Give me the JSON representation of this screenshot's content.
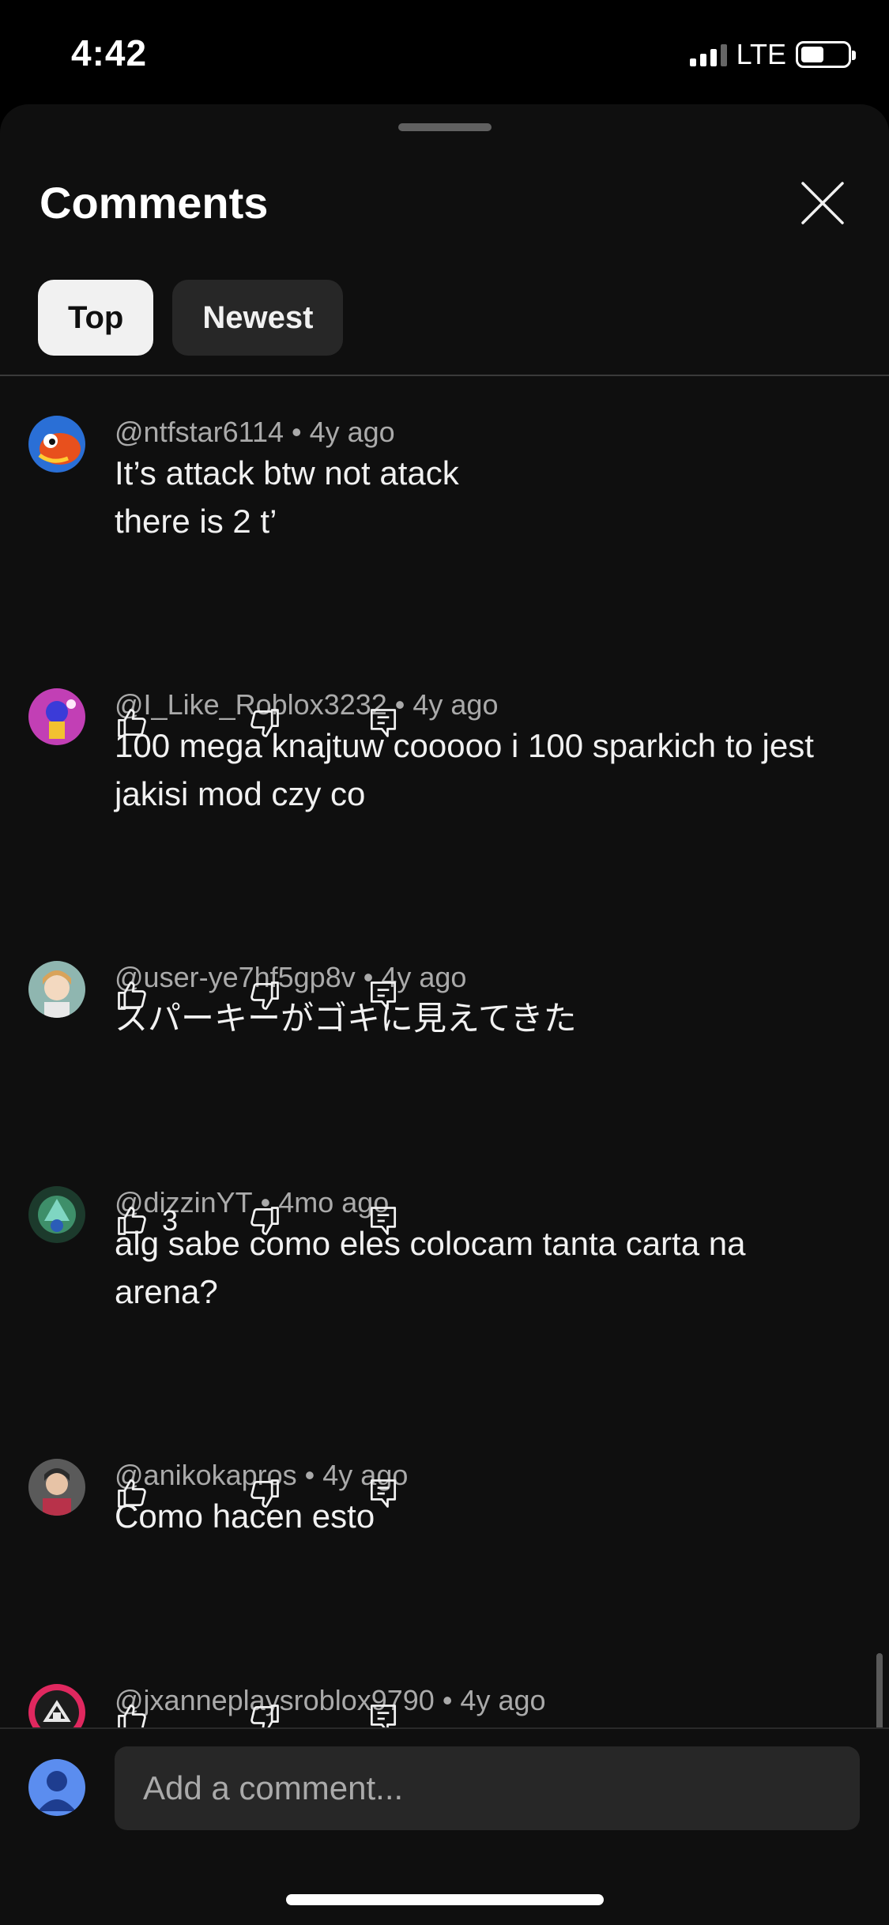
{
  "status_bar": {
    "time": "4:42",
    "network": "LTE",
    "signal_bars": 3
  },
  "sheet": {
    "title": "Comments",
    "tabs": [
      {
        "label": "Top",
        "active": true
      },
      {
        "label": "Newest",
        "active": false
      }
    ]
  },
  "comments": [
    {
      "author": "@ntfstar6114",
      "age": "4y ago",
      "text": "It’s attack btw not atack\n there is 2 t’",
      "likes": "",
      "avatar_icon": "fish-avatar-icon"
    },
    {
      "author": "@I_Like_Roblox3232",
      "age": "4y ago",
      "text": "100 mega knajtuw cooooo i 100 sparkich to jest jakisi mod czy co",
      "likes": "",
      "avatar_icon": "character-avatar-icon"
    },
    {
      "author": "@user-ye7hf5gp8v",
      "age": "4y ago",
      "text": "スパーキーがゴキに見えてきた",
      "likes": "3",
      "avatar_icon": "anime-avatar-icon"
    },
    {
      "author": "@dizzinYT",
      "age": "4mo ago",
      "text": "alg sabe como eles colocam tanta carta na arena?",
      "likes": "",
      "avatar_icon": "dragon-avatar-icon"
    },
    {
      "author": "@anikokapros",
      "age": "4y ago",
      "text": "Como hacen esto",
      "likes": "",
      "avatar_icon": "person-avatar-icon"
    },
    {
      "author": "@jxanneplaysroblox9790",
      "age": "4y ago",
      "text": "",
      "likes": "",
      "avatar_icon": "house-avatar-icon"
    }
  ],
  "composer": {
    "placeholder": "Add a comment..."
  },
  "colors": {
    "background": "#0f0f0f",
    "chip_active": "#f1f1f1",
    "chip_inactive": "#272727",
    "meta_text": "#aaaaaa"
  }
}
